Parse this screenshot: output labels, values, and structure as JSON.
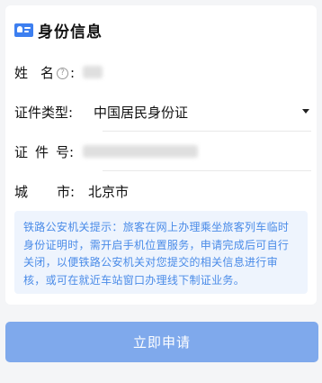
{
  "section": {
    "title": "身份信息",
    "icon": "id-card-icon"
  },
  "form": {
    "name": {
      "label_a": "姓",
      "label_b": "名",
      "colon": ":",
      "help_icon": "help-icon",
      "value_masked": true
    },
    "id_type": {
      "label": "证件类型:",
      "value": "中国居民身份证",
      "icon": "caret-down-icon"
    },
    "id_number": {
      "label_a": "证",
      "label_b": "件",
      "label_c": "号",
      "colon": ":",
      "value_masked": true
    },
    "city": {
      "label_a": "城",
      "label_b": "市",
      "colon": ":",
      "value": "北京市"
    }
  },
  "notice": {
    "text": "铁路公安机关提示：旅客在网上办理乘坐旅客列车临时身份证明时，需开启手机位置服务，申请完成后可自行关闭，以便铁路公安机关对您提交的相关信息进行审核，或可在就近车站窗口办理线下制证业务。"
  },
  "submit": {
    "label": "立即申请"
  },
  "colors": {
    "primary": "#3d7ff0",
    "button": "#7fa9ec",
    "notice_bg": "#eef4fd",
    "notice_text": "#4a8be8"
  }
}
